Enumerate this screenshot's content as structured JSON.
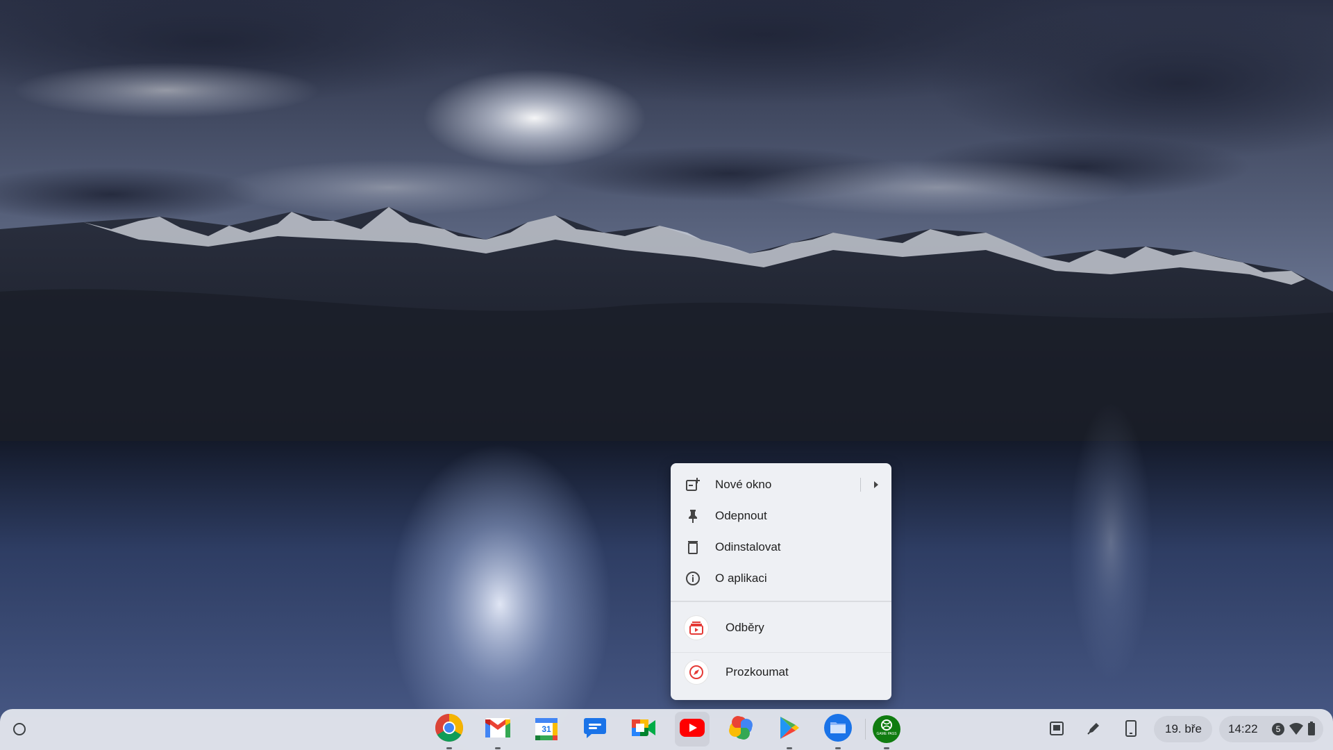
{
  "context_menu": {
    "items": [
      {
        "label": "Nové okno",
        "icon": "new-window-icon",
        "has_submenu": true
      },
      {
        "label": "Odepnout",
        "icon": "unpin-icon"
      },
      {
        "label": "Odinstalovat",
        "icon": "trash-icon"
      },
      {
        "label": "O aplikaci",
        "icon": "info-icon"
      }
    ],
    "shortcuts": [
      {
        "label": "Odběry",
        "icon": "subscriptions-icon"
      },
      {
        "label": "Prozkoumat",
        "icon": "explore-icon"
      }
    ]
  },
  "shelf": {
    "launcher_icon": "launcher-icon",
    "apps": [
      {
        "name": "Chrome",
        "icon": "chrome-icon",
        "running": true
      },
      {
        "name": "Gmail",
        "icon": "gmail-icon",
        "running": true
      },
      {
        "name": "Calendar",
        "icon": "calendar-icon",
        "label": "31",
        "running": false
      },
      {
        "name": "Chat",
        "icon": "chat-icon",
        "running": false
      },
      {
        "name": "Meet",
        "icon": "meet-icon",
        "running": false
      },
      {
        "name": "YouTube",
        "icon": "youtube-icon",
        "running": false
      },
      {
        "name": "Photos",
        "icon": "photos-icon",
        "running": false
      },
      {
        "name": "Play Store",
        "icon": "play-store-icon",
        "running": true
      },
      {
        "name": "Files",
        "icon": "files-icon",
        "running": true
      },
      {
        "name": "Game Pass",
        "icon": "xbox-game-pass-icon",
        "label": "GAME PASS",
        "running": true
      }
    ]
  },
  "status_tray": {
    "icons": [
      "holding-space-icon",
      "stylus-icon",
      "phone-hub-icon"
    ],
    "date": "19. bře",
    "time": "14:22",
    "notification_count": "5",
    "status_icons": [
      "wifi-icon",
      "battery-icon"
    ]
  },
  "colors": {
    "menu_bg": "#eef0f4",
    "shelf_bg": "#e2e5ec",
    "youtube_red": "#ff0000",
    "xbox_green": "#107c10"
  }
}
